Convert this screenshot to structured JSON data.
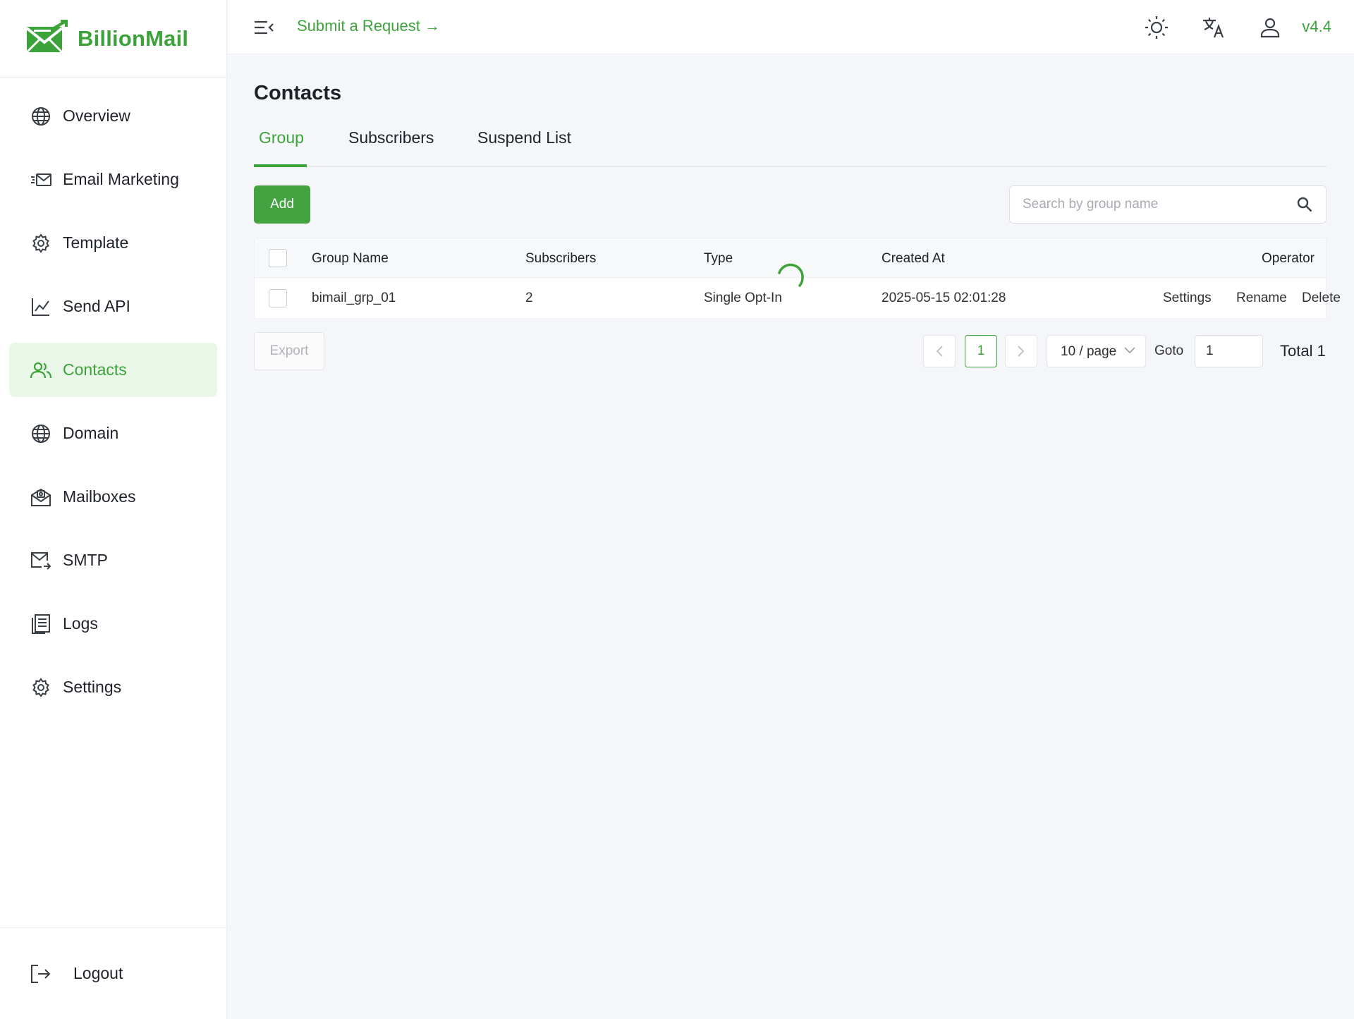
{
  "brand": {
    "name": "BillionMail",
    "accent": "#3ca33a",
    "danger": "#e5231c"
  },
  "sidebar": {
    "items": [
      {
        "label": "Overview",
        "icon": "globe-icon",
        "active": false
      },
      {
        "label": "Email Marketing",
        "icon": "email-marketing-icon",
        "active": false
      },
      {
        "label": "Template",
        "icon": "gear-icon",
        "active": false
      },
      {
        "label": "Send API",
        "icon": "line-chart-icon",
        "active": false
      },
      {
        "label": "Contacts",
        "icon": "users-icon",
        "active": true
      },
      {
        "label": "Domain",
        "icon": "globe-icon",
        "active": false
      },
      {
        "label": "Mailboxes",
        "icon": "mailbox-icon",
        "active": false
      },
      {
        "label": "SMTP",
        "icon": "mail-send-icon",
        "active": false
      },
      {
        "label": "Logs",
        "icon": "document-icon",
        "active": false
      },
      {
        "label": "Settings",
        "icon": "gear-icon",
        "active": false
      }
    ],
    "logout": "Logout"
  },
  "header": {
    "request_link": "Submit a Request",
    "version": "v4.4",
    "icons": [
      "menu-collapse-icon",
      "sun-icon",
      "translate-icon",
      "user-icon"
    ]
  },
  "page": {
    "title": "Contacts",
    "tabs": [
      {
        "label": "Group",
        "active": true
      },
      {
        "label": "Subscribers",
        "active": false
      },
      {
        "label": "Suspend List",
        "active": false
      }
    ],
    "add_button": "Add",
    "search": {
      "placeholder": "Search by group name",
      "value": ""
    },
    "table": {
      "columns": [
        "Group Name",
        "Subscribers",
        "Type",
        "Created At",
        "Operator"
      ],
      "rows": [
        {
          "group_name": "bimail_grp_01",
          "subscribers": "2",
          "type": "Single Opt-In",
          "created_at": "2025-05-15 02:01:28",
          "actions": {
            "settings": "Settings",
            "rename": "Rename",
            "delete": "Delete"
          }
        }
      ],
      "loading": true
    },
    "export_button": "Export",
    "pagination": {
      "current_page": "1",
      "page_size": "10 / page",
      "goto_label": "Goto",
      "goto_value": "1",
      "total": "Total 1"
    }
  }
}
